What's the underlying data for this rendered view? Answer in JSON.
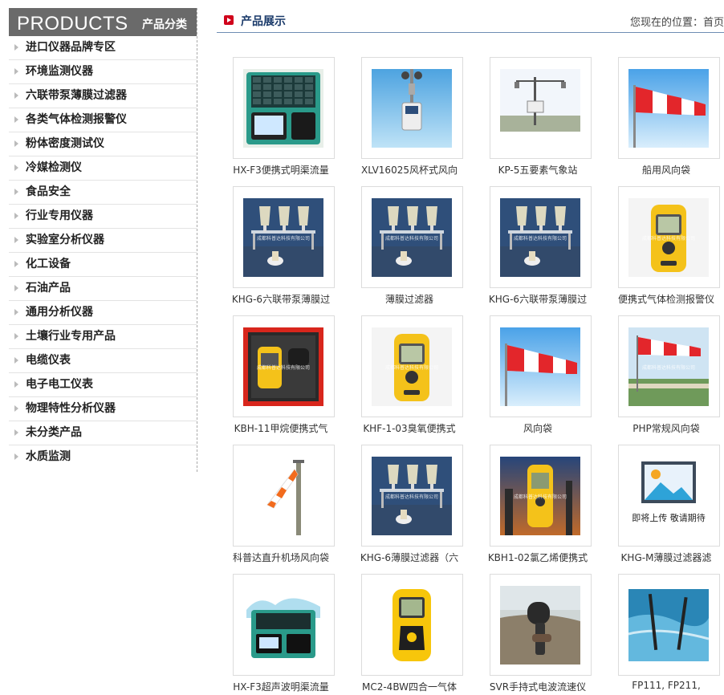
{
  "sidebar": {
    "title_en": "PRODUCTS",
    "title_cn": "产品分类",
    "items": [
      "进口仪器品牌专区",
      "环境监测仪器",
      "六联带泵薄膜过滤器",
      "各类气体检测报警仪",
      "粉体密度测试仪",
      "冷媒检测仪",
      "食品安全",
      "行业专用仪器",
      "实验室分析仪器",
      "化工设备",
      "石油产品",
      "通用分析仪器",
      "土壤行业专用产品",
      "电缆仪表",
      "电子电工仪表",
      "物理特性分析仪器",
      "未分类产品",
      "水质监测"
    ]
  },
  "header": {
    "title": "产品展示",
    "breadcrumb": "您现在的位置：首页 >"
  },
  "products": [
    {
      "caption": "HX-F3便携式明渠流量",
      "image": "case-device"
    },
    {
      "caption": "XLV16025风杯式风向",
      "image": "anemometer"
    },
    {
      "caption": "KP-5五要素气象站",
      "image": "weather-station"
    },
    {
      "caption": "船用风向袋",
      "image": "windsock-sky"
    },
    {
      "caption": "KHG-6六联带泵薄膜过",
      "image": "filter-rack"
    },
    {
      "caption": "薄膜过滤器",
      "image": "filter-rack"
    },
    {
      "caption": "KHG-6六联带泵薄膜过",
      "image": "filter-rack"
    },
    {
      "caption": "便携式气体检测报警仪",
      "image": "gas-detector-yellow"
    },
    {
      "caption": "KBH-11甲烷便携式气",
      "image": "red-case-detector"
    },
    {
      "caption": "KHF-1-03臭氧便携式",
      "image": "gas-detector-yellow"
    },
    {
      "caption": "风向袋",
      "image": "windsock-sky"
    },
    {
      "caption": "PHP常规风向袋",
      "image": "windsock-trees"
    },
    {
      "caption": "科普达直升机场风向袋",
      "image": "windsock-pole"
    },
    {
      "caption": "KHG-6薄膜过滤器（六",
      "image": "filter-rack"
    },
    {
      "caption": "KBH1-02氯乙烯便携式",
      "image": "detector-industrial"
    },
    {
      "caption": "KHG-M薄膜过滤器滤",
      "image": "placeholder"
    },
    {
      "caption": "HX-F3超声波明渠流量",
      "image": "case-splash"
    },
    {
      "caption": "MC2-4BW四合一气体",
      "image": "four-gas-detector"
    },
    {
      "caption": "SVR手持式电波流速仪",
      "image": "handheld-radar"
    },
    {
      "caption": "FP111, FP211,",
      "image": "river-probe"
    }
  ],
  "placeholder_text": "即将上传 敬请期待",
  "watermark": "成都科普达科技有限公司"
}
